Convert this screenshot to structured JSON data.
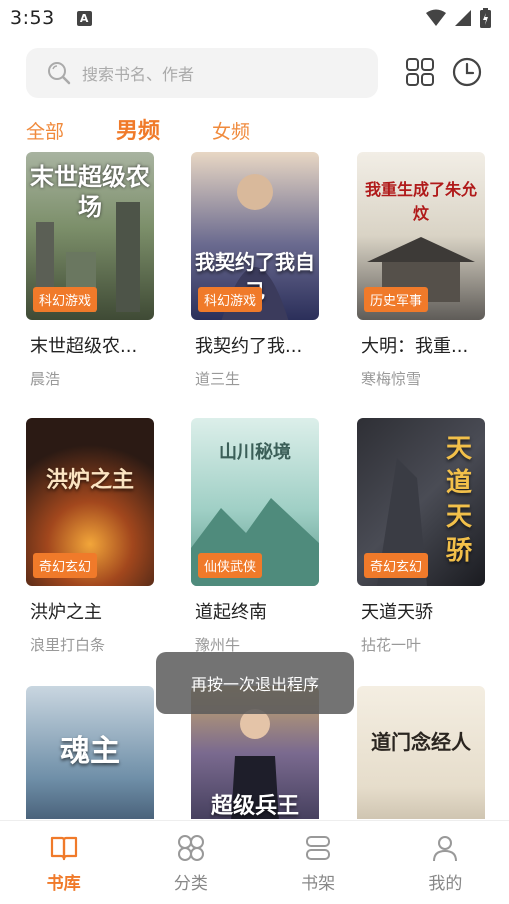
{
  "status_bar": {
    "time": "3:53",
    "notif": "A"
  },
  "search": {
    "placeholder": "搜索书名、作者"
  },
  "tabs": [
    {
      "label": "全部",
      "active": false
    },
    {
      "label": "男频",
      "active": true
    },
    {
      "label": "女频",
      "active": false
    }
  ],
  "books": [
    {
      "title": "末世超级农...",
      "author": "晨浩",
      "genre": "科幻游戏",
      "cover_text": "末世超级农场"
    },
    {
      "title": "我契约了我...",
      "author": "道三生",
      "genre": "科幻游戏",
      "cover_text": "我契约了我自己"
    },
    {
      "title": "大明：我重...",
      "author": "寒梅惊雪",
      "genre": "历史军事",
      "cover_text": "我重生成了朱允炆"
    },
    {
      "title": "洪炉之主",
      "author": "浪里打白条",
      "genre": "奇幻玄幻",
      "cover_text": "洪炉之主"
    },
    {
      "title": "道起终南",
      "author": "豫州牛",
      "genre": "仙侠武侠",
      "cover_text": "山川秘境"
    },
    {
      "title": "天道天骄",
      "author": "拈花一叶",
      "genre": "奇幻玄幻",
      "cover_text": "天道天骄"
    },
    {
      "title": "",
      "author": "",
      "genre": "",
      "cover_text": "魂主"
    },
    {
      "title": "",
      "author": "",
      "genre": "",
      "cover_text": "超级兵王"
    },
    {
      "title": "",
      "author": "",
      "genre": "",
      "cover_text": "道门念经人"
    }
  ],
  "toast": {
    "text": "再按一次退出程序"
  },
  "bottom_nav": [
    {
      "label": "书库",
      "icon": "book-open-icon",
      "active": true
    },
    {
      "label": "分类",
      "icon": "category-icon",
      "active": false
    },
    {
      "label": "书架",
      "icon": "bookshelf-icon",
      "active": false
    },
    {
      "label": "我的",
      "icon": "user-icon",
      "active": false
    }
  ],
  "colors": {
    "accent": "#f07a2a",
    "tab": "#f08a3c"
  }
}
